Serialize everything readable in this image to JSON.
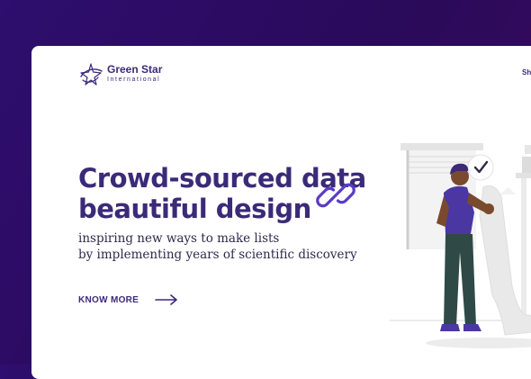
{
  "brand": {
    "name": "Green Star",
    "tagline": "International"
  },
  "nav": {
    "peek_label": "Sh"
  },
  "hero": {
    "headline_line1": "Crowd-sourced data",
    "headline_line2": "beautiful design",
    "subtext_line1": "inspiring new ways to make lists",
    "subtext_line2": "by implementing years of scientific discovery",
    "cta_label": "KNOW MORE"
  },
  "icons": {
    "logo": "star-swirl-icon",
    "link": "chain-link-icon",
    "cta": "arrow-right-icon",
    "check": "checkmark-icon"
  },
  "colors": {
    "background": "#2e0e6e",
    "brand": "#3b2a78",
    "accent": "#5b3cc4",
    "card": "#ffffff"
  }
}
